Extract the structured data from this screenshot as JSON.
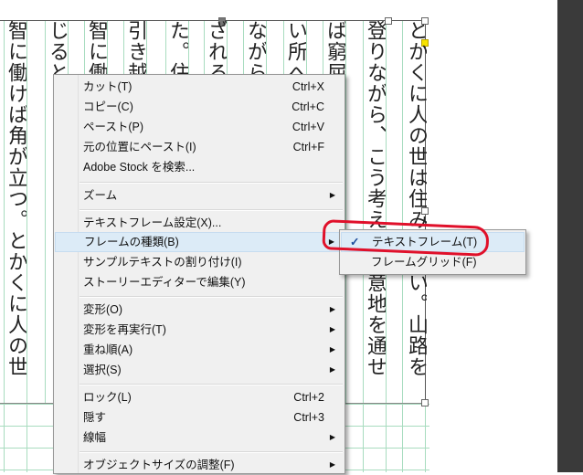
{
  "document": {
    "columns": [
      "とかくに人の世は住みにくい。山路を",
      "登りながら、こう考えた。意地を通せ",
      "ば窮屈だ",
      "い所へ",
      "ながら",
      "ざれる",
      "た。住",
      "引き越",
      "智に働",
      "じると",
      "智に働けば角が立つ。とかくに人の世"
    ]
  },
  "context_menu": {
    "items": [
      {
        "label": "カット(T)",
        "shortcut": "Ctrl+X"
      },
      {
        "label": "コピー(C)",
        "shortcut": "Ctrl+C"
      },
      {
        "label": "ペースト(P)",
        "shortcut": "Ctrl+V"
      },
      {
        "label": "元の位置にペースト(I)",
        "shortcut": "Ctrl+F"
      },
      {
        "label": "Adobe Stock を検索..."
      },
      {
        "label": "ズーム"
      },
      {
        "label": "テキストフレーム設定(X)..."
      },
      {
        "label": "フレームの種類(B)"
      },
      {
        "label": "サンプルテキストの割り付け(I)"
      },
      {
        "label": "ストーリーエディターで編集(Y)"
      },
      {
        "label": "変形(O)"
      },
      {
        "label": "変形を再実行(T)"
      },
      {
        "label": "重ね順(A)"
      },
      {
        "label": "選択(S)"
      },
      {
        "label": "ロック(L)",
        "shortcut": "Ctrl+2"
      },
      {
        "label": "隠す",
        "shortcut": "Ctrl+3"
      },
      {
        "label": "線幅"
      },
      {
        "label": "オブジェクトサイズの調整(F)"
      }
    ]
  },
  "submenu": {
    "check_glyph": "✓",
    "items": [
      {
        "label": "テキストフレーム(T)",
        "checked": true
      },
      {
        "label": "フレームグリッド(F)",
        "checked": false
      }
    ]
  },
  "colors": {
    "grid": "#a8dcbf",
    "highlight": "#dcebf7",
    "annotation": "#e0102a"
  }
}
